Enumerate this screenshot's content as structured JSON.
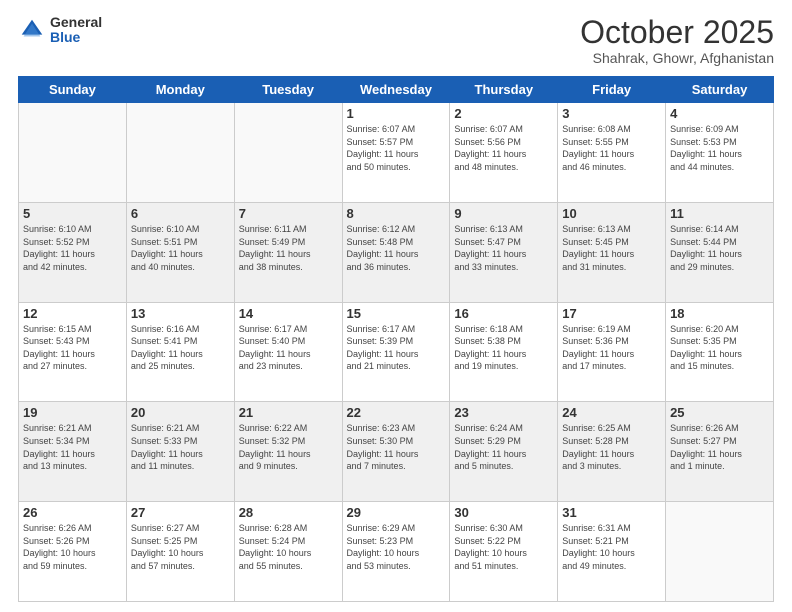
{
  "header": {
    "logo_general": "General",
    "logo_blue": "Blue",
    "month_title": "October 2025",
    "location": "Shahrak, Ghowr, Afghanistan"
  },
  "days_of_week": [
    "Sunday",
    "Monday",
    "Tuesday",
    "Wednesday",
    "Thursday",
    "Friday",
    "Saturday"
  ],
  "weeks": [
    {
      "shaded": false,
      "days": [
        {
          "num": "",
          "info": ""
        },
        {
          "num": "",
          "info": ""
        },
        {
          "num": "",
          "info": ""
        },
        {
          "num": "1",
          "info": "Sunrise: 6:07 AM\nSunset: 5:57 PM\nDaylight: 11 hours\nand 50 minutes."
        },
        {
          "num": "2",
          "info": "Sunrise: 6:07 AM\nSunset: 5:56 PM\nDaylight: 11 hours\nand 48 minutes."
        },
        {
          "num": "3",
          "info": "Sunrise: 6:08 AM\nSunset: 5:55 PM\nDaylight: 11 hours\nand 46 minutes."
        },
        {
          "num": "4",
          "info": "Sunrise: 6:09 AM\nSunset: 5:53 PM\nDaylight: 11 hours\nand 44 minutes."
        }
      ]
    },
    {
      "shaded": true,
      "days": [
        {
          "num": "5",
          "info": "Sunrise: 6:10 AM\nSunset: 5:52 PM\nDaylight: 11 hours\nand 42 minutes."
        },
        {
          "num": "6",
          "info": "Sunrise: 6:10 AM\nSunset: 5:51 PM\nDaylight: 11 hours\nand 40 minutes."
        },
        {
          "num": "7",
          "info": "Sunrise: 6:11 AM\nSunset: 5:49 PM\nDaylight: 11 hours\nand 38 minutes."
        },
        {
          "num": "8",
          "info": "Sunrise: 6:12 AM\nSunset: 5:48 PM\nDaylight: 11 hours\nand 36 minutes."
        },
        {
          "num": "9",
          "info": "Sunrise: 6:13 AM\nSunset: 5:47 PM\nDaylight: 11 hours\nand 33 minutes."
        },
        {
          "num": "10",
          "info": "Sunrise: 6:13 AM\nSunset: 5:45 PM\nDaylight: 11 hours\nand 31 minutes."
        },
        {
          "num": "11",
          "info": "Sunrise: 6:14 AM\nSunset: 5:44 PM\nDaylight: 11 hours\nand 29 minutes."
        }
      ]
    },
    {
      "shaded": false,
      "days": [
        {
          "num": "12",
          "info": "Sunrise: 6:15 AM\nSunset: 5:43 PM\nDaylight: 11 hours\nand 27 minutes."
        },
        {
          "num": "13",
          "info": "Sunrise: 6:16 AM\nSunset: 5:41 PM\nDaylight: 11 hours\nand 25 minutes."
        },
        {
          "num": "14",
          "info": "Sunrise: 6:17 AM\nSunset: 5:40 PM\nDaylight: 11 hours\nand 23 minutes."
        },
        {
          "num": "15",
          "info": "Sunrise: 6:17 AM\nSunset: 5:39 PM\nDaylight: 11 hours\nand 21 minutes."
        },
        {
          "num": "16",
          "info": "Sunrise: 6:18 AM\nSunset: 5:38 PM\nDaylight: 11 hours\nand 19 minutes."
        },
        {
          "num": "17",
          "info": "Sunrise: 6:19 AM\nSunset: 5:36 PM\nDaylight: 11 hours\nand 17 minutes."
        },
        {
          "num": "18",
          "info": "Sunrise: 6:20 AM\nSunset: 5:35 PM\nDaylight: 11 hours\nand 15 minutes."
        }
      ]
    },
    {
      "shaded": true,
      "days": [
        {
          "num": "19",
          "info": "Sunrise: 6:21 AM\nSunset: 5:34 PM\nDaylight: 11 hours\nand 13 minutes."
        },
        {
          "num": "20",
          "info": "Sunrise: 6:21 AM\nSunset: 5:33 PM\nDaylight: 11 hours\nand 11 minutes."
        },
        {
          "num": "21",
          "info": "Sunrise: 6:22 AM\nSunset: 5:32 PM\nDaylight: 11 hours\nand 9 minutes."
        },
        {
          "num": "22",
          "info": "Sunrise: 6:23 AM\nSunset: 5:30 PM\nDaylight: 11 hours\nand 7 minutes."
        },
        {
          "num": "23",
          "info": "Sunrise: 6:24 AM\nSunset: 5:29 PM\nDaylight: 11 hours\nand 5 minutes."
        },
        {
          "num": "24",
          "info": "Sunrise: 6:25 AM\nSunset: 5:28 PM\nDaylight: 11 hours\nand 3 minutes."
        },
        {
          "num": "25",
          "info": "Sunrise: 6:26 AM\nSunset: 5:27 PM\nDaylight: 11 hours\nand 1 minute."
        }
      ]
    },
    {
      "shaded": false,
      "days": [
        {
          "num": "26",
          "info": "Sunrise: 6:26 AM\nSunset: 5:26 PM\nDaylight: 10 hours\nand 59 minutes."
        },
        {
          "num": "27",
          "info": "Sunrise: 6:27 AM\nSunset: 5:25 PM\nDaylight: 10 hours\nand 57 minutes."
        },
        {
          "num": "28",
          "info": "Sunrise: 6:28 AM\nSunset: 5:24 PM\nDaylight: 10 hours\nand 55 minutes."
        },
        {
          "num": "29",
          "info": "Sunrise: 6:29 AM\nSunset: 5:23 PM\nDaylight: 10 hours\nand 53 minutes."
        },
        {
          "num": "30",
          "info": "Sunrise: 6:30 AM\nSunset: 5:22 PM\nDaylight: 10 hours\nand 51 minutes."
        },
        {
          "num": "31",
          "info": "Sunrise: 6:31 AM\nSunset: 5:21 PM\nDaylight: 10 hours\nand 49 minutes."
        },
        {
          "num": "",
          "info": ""
        }
      ]
    }
  ]
}
